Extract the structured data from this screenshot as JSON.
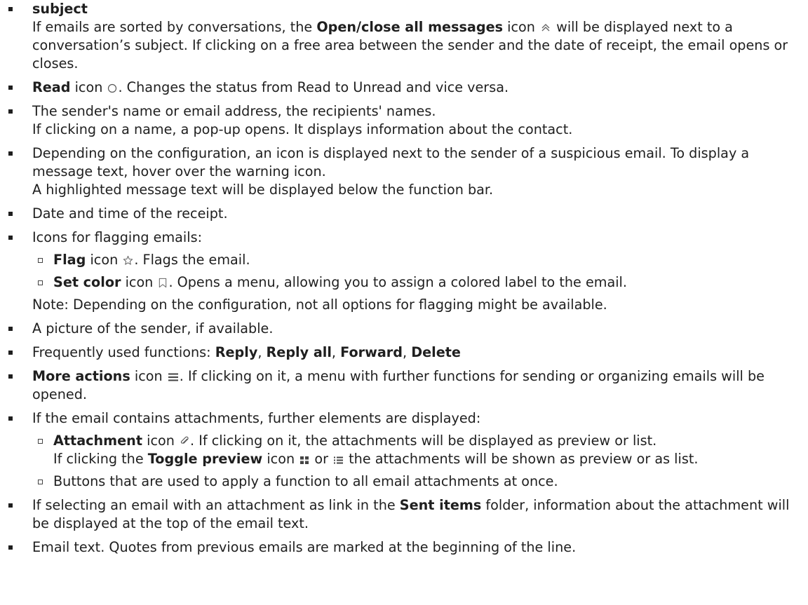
{
  "items": {
    "subject": {
      "title": "subject",
      "text_a": "If emails are sorted by conversations, the ",
      "bold": "Open/close all messages",
      "text_b": " icon ",
      "text_c": " will be displayed next to a conversation’s subject. If clicking on a free area between the sender and the date of receipt, the email opens or closes."
    },
    "read": {
      "bold": "Read",
      "text_a": " icon ",
      "text_b": ". Changes the status from Read to Unread and vice versa."
    },
    "sender": {
      "line1": "The sender's name or email address, the recipients' names.",
      "line2": "If clicking on a name, a pop-up opens. It displays information about the contact."
    },
    "suspicious": {
      "line1": "Depending on the configuration, an icon is displayed next to the sender of a suspicious email. To display a message text, hover over the warning icon.",
      "line2": "A highlighted message text will be displayed below the function bar."
    },
    "date": {
      "text": "Date and time of the receipt."
    },
    "flagging": {
      "text": "Icons for flagging emails:",
      "flag": {
        "bold": "Flag",
        "text_a": " icon ",
        "text_b": ". Flags the email."
      },
      "color": {
        "bold": "Set color",
        "text_a": " icon ",
        "text_b": ". Opens a menu, allowing you to assign a colored label to the email."
      },
      "note": "Note: Depending on the configuration, not all options for flagging might be available."
    },
    "picture": {
      "text": "A picture of the sender, if available."
    },
    "functions": {
      "text": "Frequently used functions: ",
      "reply": "Reply",
      "sep1": ", ",
      "reply_all": "Reply all",
      "sep2": ", ",
      "forward": "Forward",
      "sep3": ", ",
      "delete": "Delete"
    },
    "more": {
      "bold": "More actions",
      "text_a": " icon ",
      "text_b": ". If clicking on it, a menu with further functions for sending or organizing emails will be opened."
    },
    "attachments": {
      "text": "If the email contains attachments, further elements are displayed:",
      "attachment": {
        "bold": "Attachment",
        "text_a": " icon ",
        "text_b": ". If clicking on it, the attachments will be displayed as preview or list.",
        "line2_a": "If clicking the ",
        "line2_bold": "Toggle preview",
        "line2_b": " icon ",
        "line2_c": " or ",
        "line2_d": " the attachments will be shown as preview or as list."
      },
      "buttons": "Buttons that are used to apply a function to all email attachments at once."
    },
    "sent": {
      "text_a": "If selecting an email with an attachment as link in the ",
      "bold": "Sent items",
      "text_b": " folder, information about the at­tachment will be displayed at the top of the email text."
    },
    "emailtext": {
      "text": "Email text. Quotes from previous emails are marked at the beginning of the line."
    }
  },
  "icons": {
    "open_close": "double-chevron-up-icon",
    "read": "circle-icon",
    "flag": "star-icon",
    "set_color": "bookmark-icon",
    "more_actions": "hamburger-menu-icon",
    "attachment": "paperclip-icon",
    "toggle_grid": "grid-icon",
    "toggle_list": "list-icon"
  }
}
